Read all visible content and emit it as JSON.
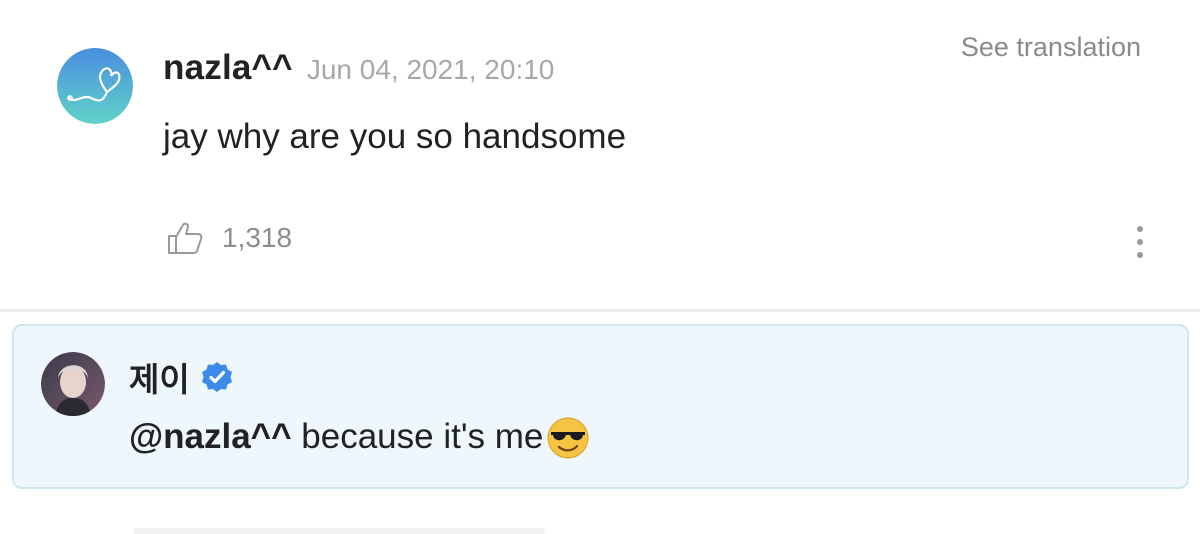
{
  "comment": {
    "author": "nazla^^",
    "timestamp": "Jun 04, 2021, 20:10",
    "translate_label": "See translation",
    "text": "jay why are you so handsome",
    "like_count": "1,318",
    "avatar_icon": "heart-swirl-avatar",
    "avatar_colors": [
      "#4a8ee0",
      "#5fd3c8"
    ]
  },
  "reply": {
    "author": "제이",
    "verified_icon": "verified-badge-icon",
    "verified_color": "#3d8be8",
    "mention": "@nazla^^",
    "text": " because it's me",
    "emoji": "smiling-face-with-sunglasses",
    "background": "#eef8fc",
    "border": "#cfe6ee"
  }
}
